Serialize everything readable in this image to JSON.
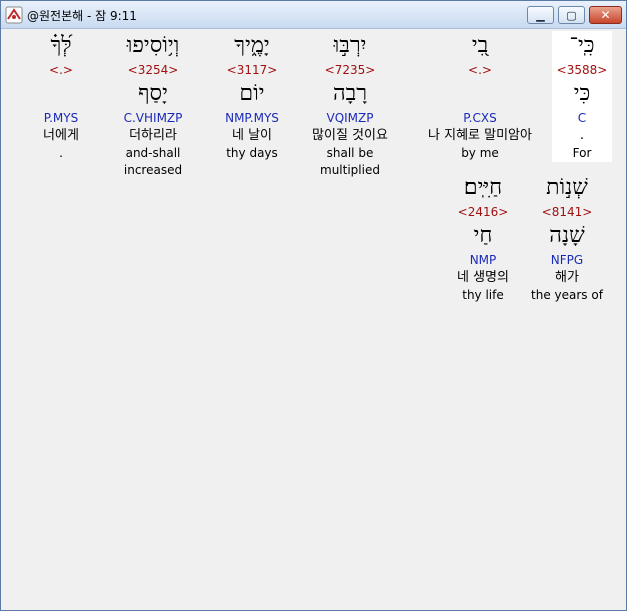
{
  "window": {
    "title": "@원전본해 - 잠 9:11"
  },
  "words": [
    {
      "heb": "כִּֽי־",
      "strong": "<3588>",
      "lemma": "כִּי",
      "morph": "C",
      "kor": ".",
      "eng": "For",
      "highlight": true
    },
    {
      "heb": "בִ֭י",
      "strong": "<.>",
      "lemma": "",
      "morph": "P.CXS",
      "kor": "나 지혜로 말미암아",
      "eng": "by me",
      "highlight": false
    },
    {
      "heb": "יִרְבּ֣וּ",
      "strong": "<7235>",
      "lemma": "רָבָה",
      "morph": "VQIMZP",
      "kor": "많이질 것이요",
      "eng": "shall be multiplied",
      "highlight": false
    },
    {
      "heb": "יָמֶ֑יךָ",
      "strong": "<3117>",
      "lemma": "יוֹם",
      "morph": "NMP.MYS",
      "kor": "네 날이",
      "eng": "thy days",
      "highlight": false
    },
    {
      "heb": "וְי֥וֹסִיפוּ",
      "strong": "<3254>",
      "lemma": "יָסַף",
      "morph": "C.VHIMZP",
      "kor": "더하리라",
      "eng": "and-shall increased",
      "highlight": false
    },
    {
      "heb": "לְּ֝ךָ֗",
      "strong": "<.>",
      "lemma": "",
      "morph": "P.MYS",
      "kor": "너에게",
      "eng": ".",
      "highlight": false
    },
    {
      "heb": "שְׁנ֣וֹת",
      "strong": "<8141>",
      "lemma": "שָׁנָה",
      "morph": "NFPG",
      "kor": "해가",
      "eng": "the years of",
      "highlight": false
    },
    {
      "heb": "חַיִּֽים׃",
      "strong": "<2416>",
      "lemma": "חַי",
      "morph": "NMP",
      "kor": "네 생명의",
      "eng": "thy life",
      "highlight": false
    }
  ]
}
